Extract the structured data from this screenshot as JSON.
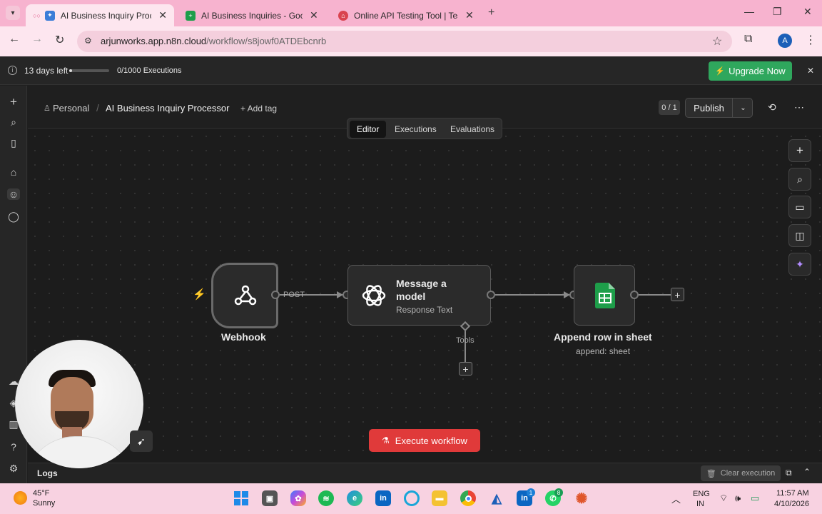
{
  "browser": {
    "tabs": [
      {
        "title": "AI Business Inquiry Processo",
        "close": "✕",
        "active": true
      },
      {
        "title": "AI Business Inquiries - Google S",
        "close": "✕",
        "active": false
      },
      {
        "title": "Online API Testing Tool | Test Yo",
        "close": "✕",
        "active": false
      }
    ],
    "new_tab": "+",
    "url_host": "arjunworks.app.n8n.cloud",
    "url_path": "/workflow/s8jowf0ATDEbcnrb",
    "profile_initial": "A"
  },
  "banner": {
    "days_left": "13 days left",
    "executions": "0/1000 Executions",
    "upgrade_label": "Upgrade Now",
    "close": "✕"
  },
  "header": {
    "project": "Personal",
    "separator": "/",
    "workflow_name": "AI Business Inquiry Processor",
    "add_tag": "+ Add tag",
    "version_counter": "0 / 1",
    "publish_label": "Publish",
    "more": "⋯"
  },
  "view_tabs": [
    {
      "label": "Editor",
      "active": true
    },
    {
      "label": "Executions",
      "active": false
    },
    {
      "label": "Evaluations",
      "active": false
    }
  ],
  "nodes": {
    "webhook": {
      "name": "Webhook",
      "method": "POST"
    },
    "llm": {
      "title": "Message a model",
      "subtitle": "Response Text",
      "tools_label": "Tools"
    },
    "sheets": {
      "name": "Append row in sheet",
      "subtitle": "append: sheet"
    }
  },
  "execute_label": "Execute workflow",
  "logs": {
    "label": "Logs",
    "clear_label": "Clear execution"
  },
  "taskbar": {
    "weather_temp": "45°F",
    "weather_desc": "Sunny",
    "lang_top": "ENG",
    "lang_bottom": "IN",
    "time": "11:57 AM",
    "date": "4/10/2026",
    "linkedin_badge": "1",
    "whatsapp_badge": "8"
  },
  "colors": {
    "accent_green": "#2fa75d",
    "execute_red": "#e03a3a",
    "tab_strip": "#f7b3cf",
    "sheets_green": "#1e9e4a"
  }
}
